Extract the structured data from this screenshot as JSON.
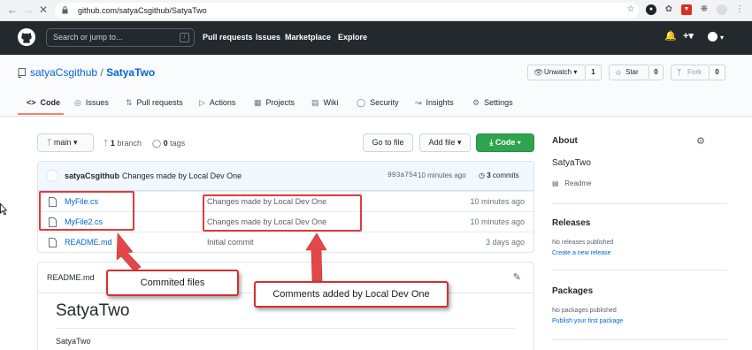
{
  "browser": {
    "url": "github.com/satyaCsgithub/SatyaTwo"
  },
  "github_header": {
    "search_placeholder": "Search or jump to...",
    "search_shortcut": "/",
    "nav": [
      "Pull requests",
      "Issues",
      "Marketplace",
      "Explore"
    ]
  },
  "repo": {
    "owner": "satyaCsgithub",
    "separator": "/",
    "name": "SatyaTwo",
    "unwatch_label": "Unwatch",
    "watch_count": "1",
    "star_label": "Star",
    "star_count": "0",
    "fork_label": "Fork",
    "fork_count": "0",
    "tabs": [
      "Code",
      "Issues",
      "Pull requests",
      "Actions",
      "Projects",
      "Wiki",
      "Security",
      "Insights",
      "Settings"
    ],
    "active_tab": "Code"
  },
  "toolbar": {
    "branch": "main",
    "branch_count": "1",
    "branch_label": "branch",
    "tag_count": "0",
    "tag_label": "tags",
    "go_to_file": "Go to file",
    "add_file": "Add file",
    "code": "Code"
  },
  "latest_commit": {
    "author": "satyaCsgithub",
    "message": "Changes made by Local Dev One",
    "sha": "993a754",
    "age": "10 minutes ago",
    "commit_count": "3",
    "commit_label": "commits"
  },
  "files": [
    {
      "name": "MyFile.cs",
      "message": "Changes made by Local Dev One",
      "age": "10 minutes ago"
    },
    {
      "name": "MyFile2.cs",
      "message": "Changes made by Local Dev One",
      "age": "10 minutes ago"
    },
    {
      "name": "README.md",
      "message": "Initial commit",
      "age": "3 days ago"
    }
  ],
  "readme": {
    "filename": "README.md",
    "heading": "SatyaTwo",
    "body": "SatyaTwo"
  },
  "sidebar": {
    "about_heading": "About",
    "about_text": "SatyaTwo",
    "readme_link": "Readme",
    "releases_heading": "Releases",
    "releases_text": "No releases published",
    "releases_link": "Create a new release",
    "packages_heading": "Packages",
    "packages_text": "No packages published",
    "packages_link": "Publish your first package"
  },
  "annotations": {
    "committed_files": "Commited files",
    "comments_added": "Comments added by Local Dev One",
    "highlight_color": "#e03b3b"
  },
  "colors": {
    "header_bg": "#24292e",
    "link": "#0366d6",
    "code_button": "#2ea44f",
    "tab_underline": "#f9826c"
  }
}
